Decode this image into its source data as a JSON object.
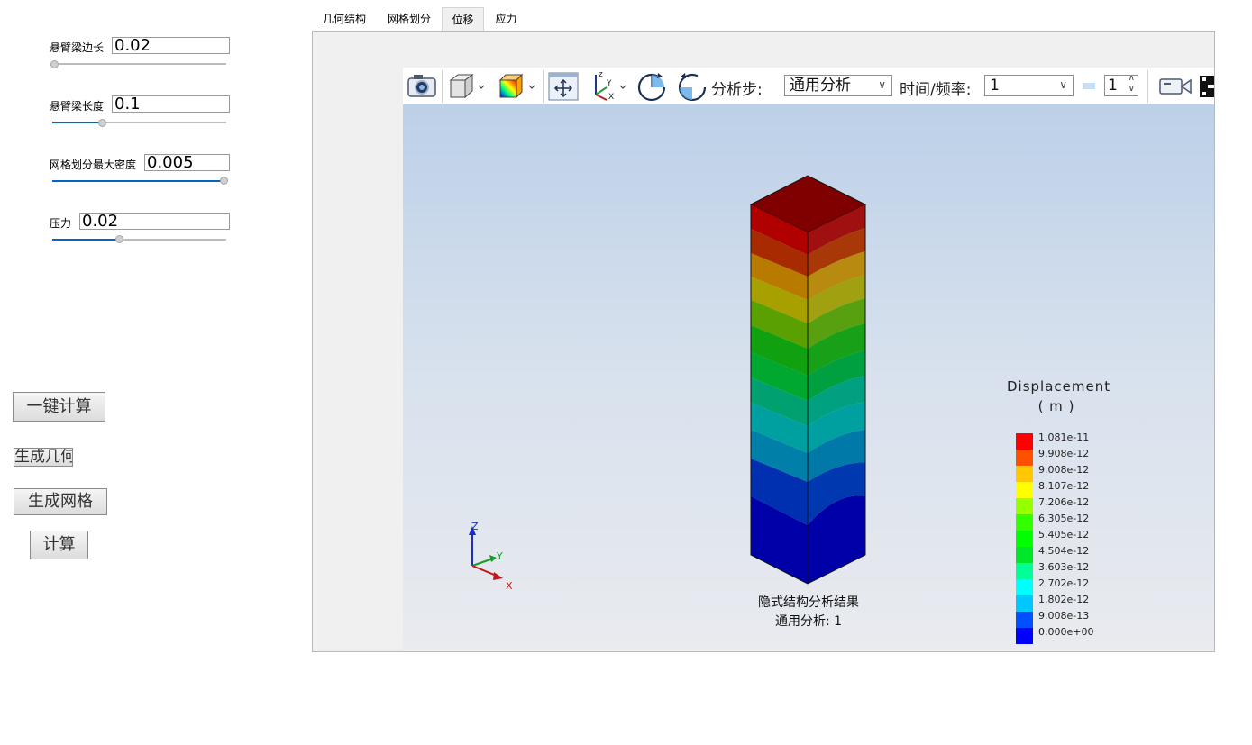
{
  "params": [
    {
      "label": "悬臂梁边长",
      "value": "0.02",
      "slider": 0.0
    },
    {
      "label": "悬臂梁长度",
      "value": "0.1",
      "slider": 0.28
    },
    {
      "label": "网格划分最大密度",
      "value": "0.005",
      "slider": 1.0
    },
    {
      "label": "压力",
      "value": "0.02",
      "slider": 0.38
    }
  ],
  "buttons": {
    "compute_all": "一键计算",
    "gen_geometry": "生成几何",
    "gen_mesh": "生成网格",
    "compute": "计算"
  },
  "tabs": [
    {
      "label": "几何结构",
      "active": false
    },
    {
      "label": "网格划分",
      "active": false
    },
    {
      "label": "位移",
      "active": true
    },
    {
      "label": "应力",
      "active": false
    }
  ],
  "toolbar": {
    "analysis_step_label": "分析步:",
    "analysis_step_value": "通用分析",
    "time_freq_label": "时间/频率:",
    "time_freq_value": "1",
    "frame_value": "1",
    "icons": [
      "camera-icon",
      "cube-view-icon",
      "contour-icon",
      "pan-icon",
      "axes-icon",
      "rotate-cw-icon",
      "rotate-ccw-icon",
      "video-camera-icon"
    ]
  },
  "viewport": {
    "caption_line1": "隐式结构分析结果",
    "caption_line2": "通用分析: 1",
    "triad": {
      "z": "Z",
      "y": "Y",
      "x": "X"
    }
  },
  "legend": {
    "title": "Displacement",
    "unit": "( m )",
    "entries": [
      {
        "value": "1.081e-11",
        "color": "#ff0000"
      },
      {
        "value": "9.908e-12",
        "color": "#ff5000"
      },
      {
        "value": "9.008e-12",
        "color": "#ffc800"
      },
      {
        "value": "8.107e-12",
        "color": "#ffff00"
      },
      {
        "value": "7.206e-12",
        "color": "#96ff00"
      },
      {
        "value": "6.305e-12",
        "color": "#32ff00"
      },
      {
        "value": "5.405e-12",
        "color": "#00ff00"
      },
      {
        "value": "4.504e-12",
        "color": "#00e628"
      },
      {
        "value": "3.603e-12",
        "color": "#00ff96"
      },
      {
        "value": "2.702e-12",
        "color": "#00ffff"
      },
      {
        "value": "1.802e-12",
        "color": "#00c8ff"
      },
      {
        "value": "9.008e-13",
        "color": "#0050ff"
      },
      {
        "value": "0.000e+00",
        "color": "#0000ff"
      }
    ]
  }
}
